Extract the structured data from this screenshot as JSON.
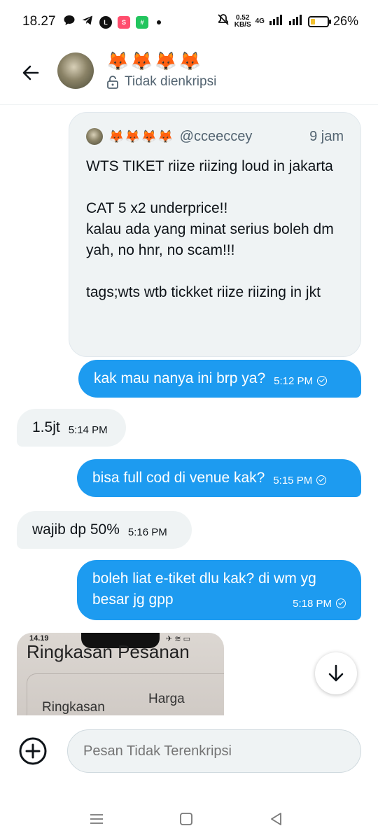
{
  "status_bar": {
    "time": "18.27",
    "speed": "0.52",
    "speed_unit": "KB/S",
    "network": "4G",
    "battery": "26%",
    "battery_level": 0.26,
    "battery_color": "#f2c12e"
  },
  "header": {
    "name": "🦊🦊🦊🦊",
    "encryption": "Tidak dienkripsi"
  },
  "quoted_tweet": {
    "name": "🦊🦊🦊🦊",
    "handle": "@cceeccey",
    "time": "9 jam",
    "text": "WTS TIKET riize riizing loud in jakarta\n\nCAT 5 x2 underprice!!\nkalau ada yang minat serius boleh dm yah, no hnr, no scam!!!\n\ntags;wts wtb tickket riize riizing in jkt"
  },
  "messages": [
    {
      "dir": "out",
      "text": "kak mau nanya ini brp ya?",
      "time": "5:12 PM"
    },
    {
      "dir": "in",
      "text": "1.5jt",
      "time": "5:14 PM"
    },
    {
      "dir": "out",
      "text": "bisa full cod di venue kak?",
      "time": "5:15 PM"
    },
    {
      "dir": "in",
      "text": "wajib dp 50%",
      "time": "5:16 PM"
    },
    {
      "dir": "out",
      "text": "boleh liat e-tiket dlu kak? di wm yg besar jg gpp",
      "time": "5:18 PM"
    }
  ],
  "image_preview": {
    "status_time": "14.19",
    "title": "Ringkasan Pesanan",
    "left_label": "Ringkasan",
    "right_label": "Harga"
  },
  "composer": {
    "placeholder": "Pesan Tidak Terenkripsi"
  },
  "colors": {
    "accent": "#1d9bf0",
    "incoming_bg": "#eff3f4",
    "secondary_text": "#536471"
  }
}
